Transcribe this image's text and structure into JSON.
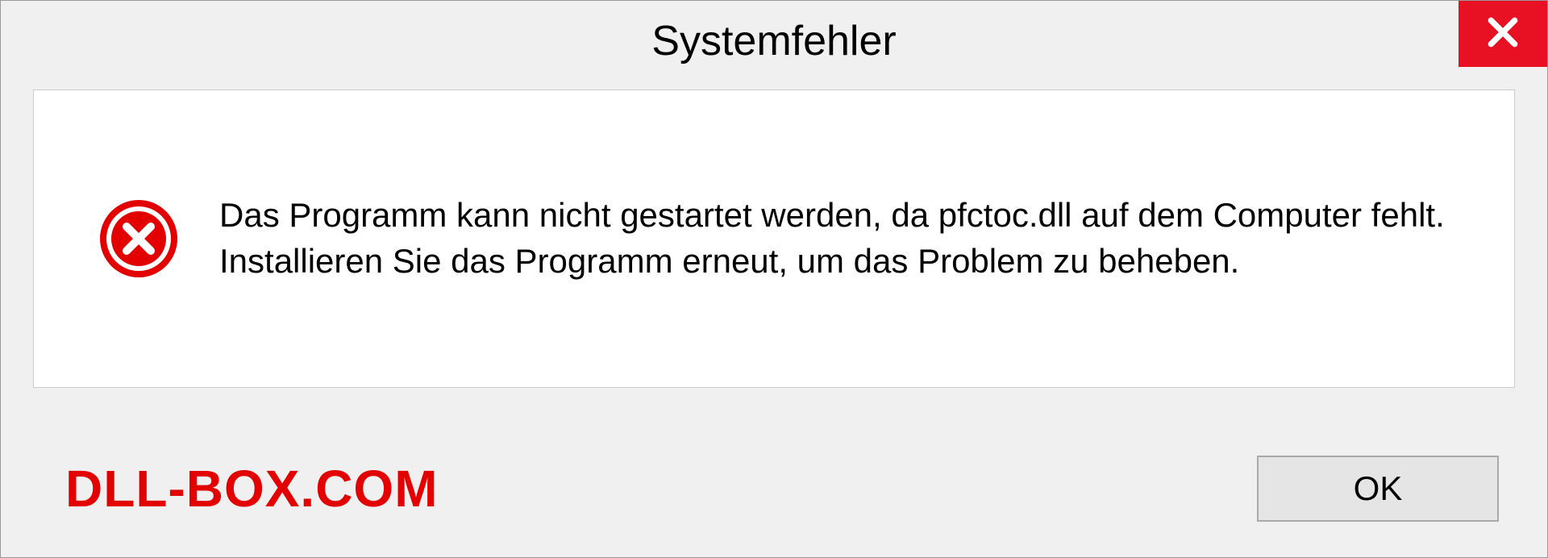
{
  "dialog": {
    "title": "Systemfehler",
    "message": "Das Programm kann nicht gestartet werden, da pfctoc.dll auf dem Computer fehlt. Installieren Sie das Programm erneut, um das Problem zu beheben.",
    "ok_label": "OK"
  },
  "watermark": "DLL-BOX.COM"
}
